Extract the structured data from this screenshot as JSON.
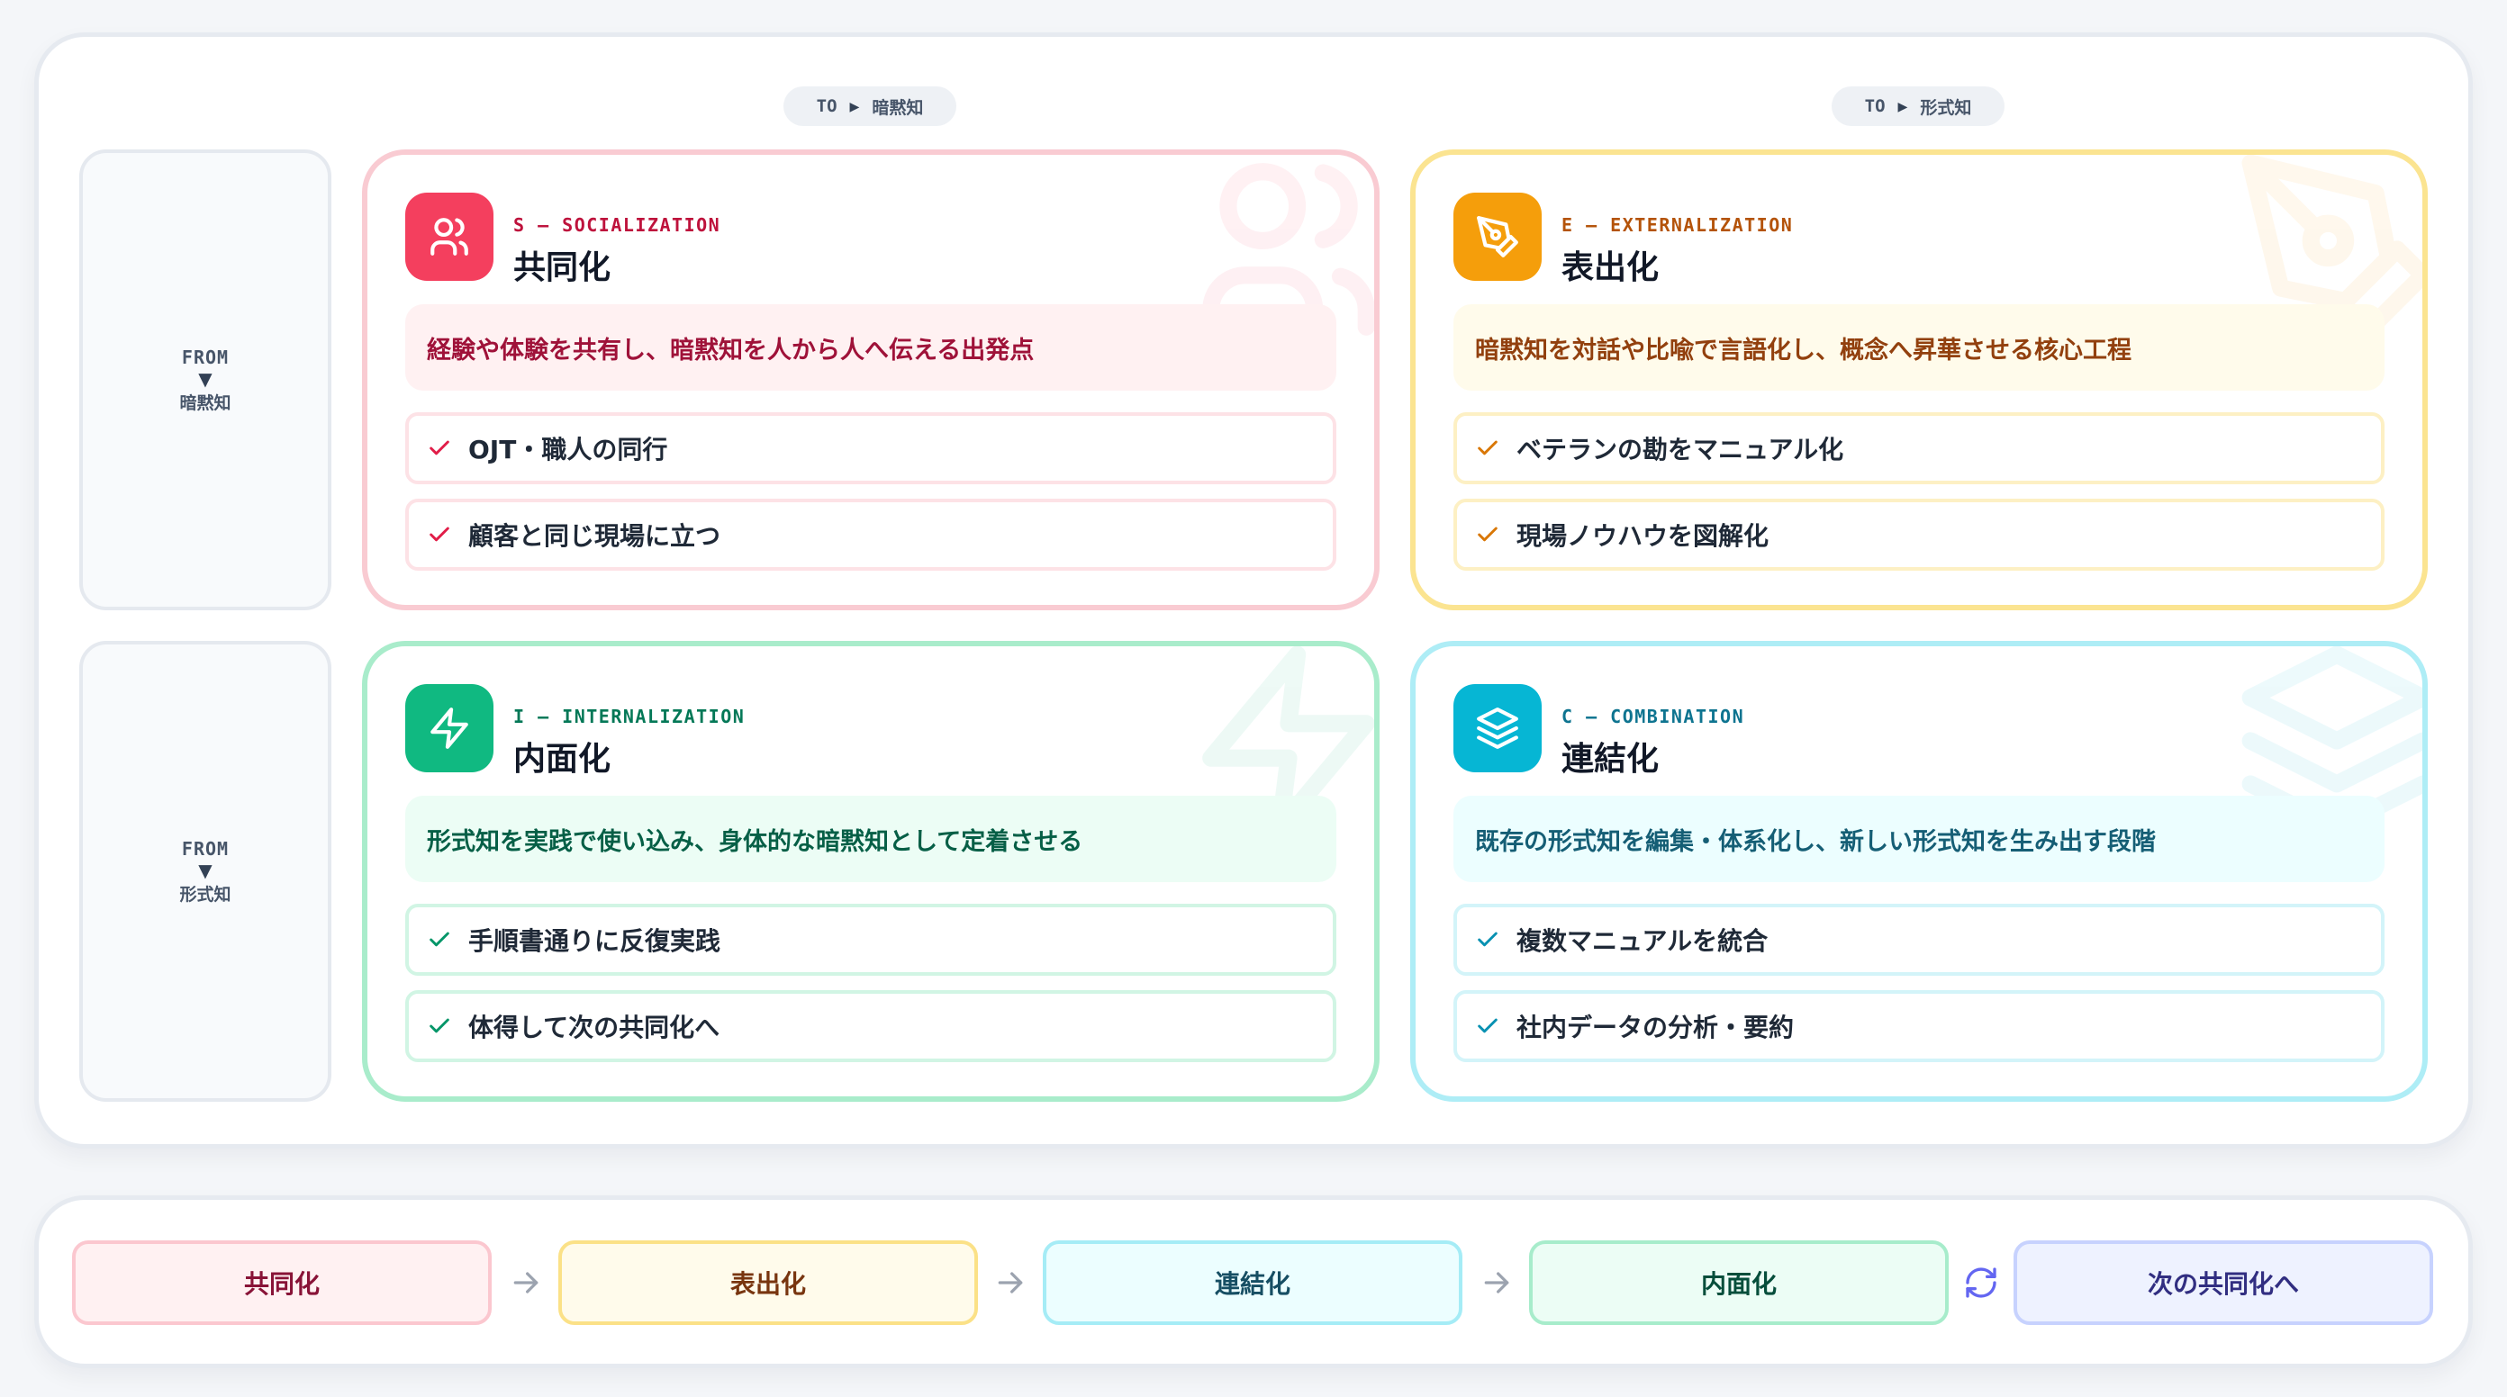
{
  "columns": [
    {
      "to_label": "TO",
      "target": "暗黙知"
    },
    {
      "to_label": "TO",
      "target": "形式知"
    }
  ],
  "rows": [
    {
      "from_label": "FROM",
      "arrow": "▼",
      "source": "暗黙知"
    },
    {
      "from_label": "FROM",
      "arrow": "▼",
      "source": "形式知"
    }
  ],
  "cards": {
    "socialization": {
      "code": "S — SOCIALIZATION",
      "title": "共同化",
      "icon": "users-icon",
      "summary": "経験や体験を共有し、暗黙知を人から人へ伝える出発点",
      "points": [
        "OJT・職人の同行",
        "顧客と同じ現場に立つ"
      ],
      "accent": "#f43f5e"
    },
    "externalization": {
      "code": "E — EXTERNALIZATION",
      "title": "表出化",
      "icon": "pen-tool-icon",
      "summary": "暗黙知を対話や比喩で言語化し、概念へ昇華させる核心工程",
      "points": [
        "ベテランの勘をマニュアル化",
        "現場ノウハウを図解化"
      ],
      "accent": "#f59e0b"
    },
    "internalization": {
      "code": "I — INTERNALIZATION",
      "title": "内面化",
      "icon": "lightning-icon",
      "summary": "形式知を実践で使い込み、身体的な暗黙知として定着させる",
      "points": [
        "手順書通りに反復実践",
        "体得して次の共同化へ"
      ],
      "accent": "#10b981"
    },
    "combination": {
      "code": "C — COMBINATION",
      "title": "連結化",
      "icon": "layers-icon",
      "summary": "既存の形式知を編集・体系化し、新しい形式知を生み出す段階",
      "points": [
        "複数マニュアルを統合",
        "社内データの分析・要約"
      ],
      "accent": "#06b6d4"
    }
  },
  "flow": {
    "steps": [
      "共同化",
      "表出化",
      "連結化",
      "内面化",
      "次の共同化へ"
    ],
    "connectors": [
      "arrow-right-icon",
      "arrow-right-icon",
      "arrow-right-icon",
      "refresh-cycle-icon"
    ]
  }
}
